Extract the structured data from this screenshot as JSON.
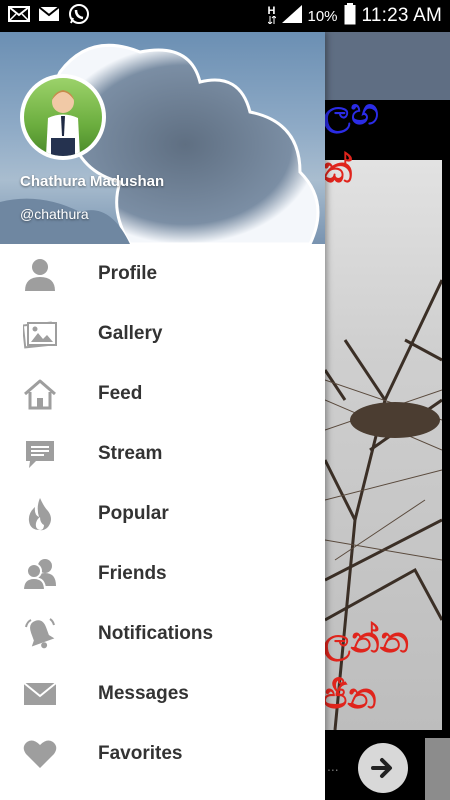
{
  "status_bar": {
    "network_label": "H",
    "battery_percent": "10%",
    "time": "11:23 AM",
    "notification_icons": [
      "email-icon",
      "email-icon",
      "whatsapp-icon"
    ]
  },
  "drawer": {
    "user": {
      "name": "Chathura Madushan",
      "handle": "@chathura"
    },
    "items": [
      {
        "label": "Profile",
        "icon": "person-icon"
      },
      {
        "label": "Gallery",
        "icon": "gallery-icon"
      },
      {
        "label": "Feed",
        "icon": "home-icon"
      },
      {
        "label": "Stream",
        "icon": "chat-icon"
      },
      {
        "label": "Popular",
        "icon": "flame-icon"
      },
      {
        "label": "Friends",
        "icon": "friends-icon"
      },
      {
        "label": "Notifications",
        "icon": "bell-icon"
      },
      {
        "label": "Messages",
        "icon": "envelope-icon"
      },
      {
        "label": "Favorites",
        "icon": "heart-icon"
      }
    ]
  },
  "background_app": {
    "sinhala_line1": "ලහ",
    "sinhala_line2": "ක්",
    "sinhala_line3": "ලන්න",
    "sinhala_line4": "ජීන",
    "bottom_dots": "..."
  },
  "colors": {
    "icon_gray": "#9e9e9e",
    "label_text": "#333333",
    "drawer_bg": "#ffffff"
  }
}
